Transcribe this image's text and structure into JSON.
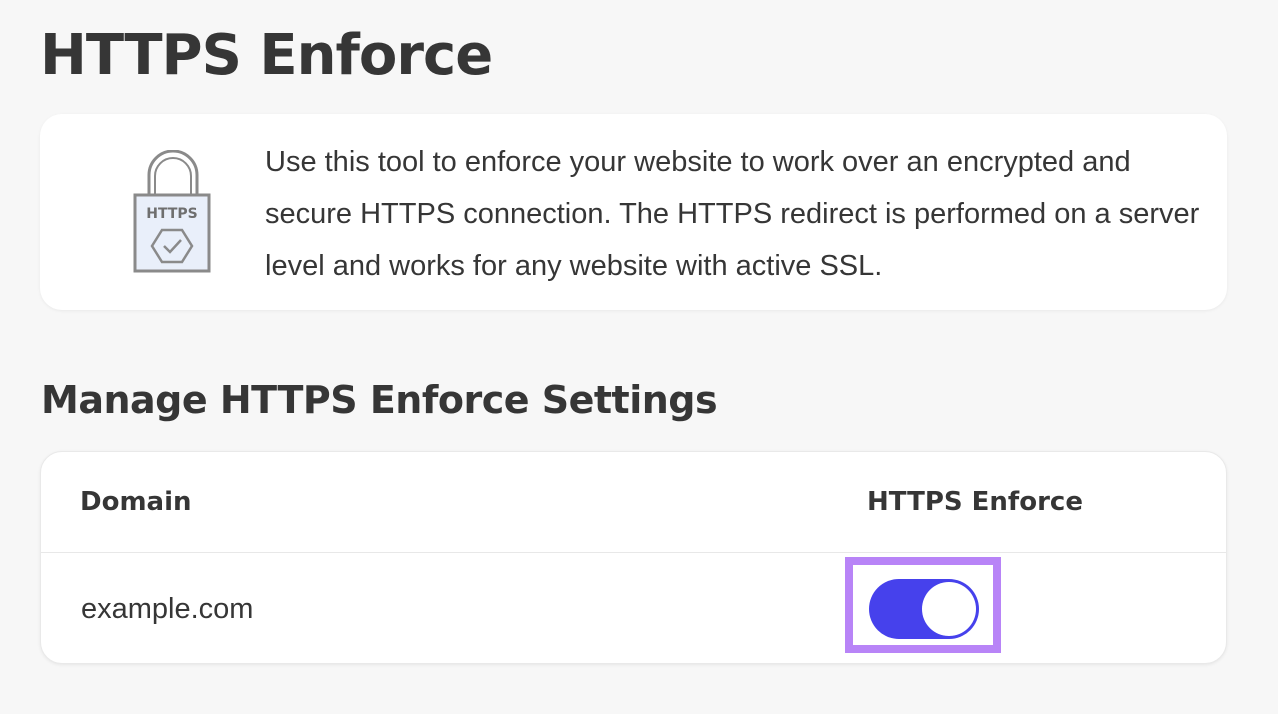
{
  "page": {
    "title": "HTTPS Enforce"
  },
  "info": {
    "icon": "https-lock-icon",
    "icon_label": "HTTPS",
    "description": "Use this tool to enforce your website to work over an encrypted and secure HTTPS connection. The HTTPS redirect is performed on a server level and works for any website with active SSL."
  },
  "settings": {
    "title": "Manage HTTPS Enforce Settings",
    "columns": [
      "Domain",
      "HTTPS Enforce"
    ],
    "rows": [
      {
        "domain": "example.com",
        "https_enforce": true
      }
    ]
  },
  "colors": {
    "toggle_on": "#4641ec",
    "highlight": "#b884f7",
    "text": "#363636",
    "background": "#f7f7f7"
  }
}
